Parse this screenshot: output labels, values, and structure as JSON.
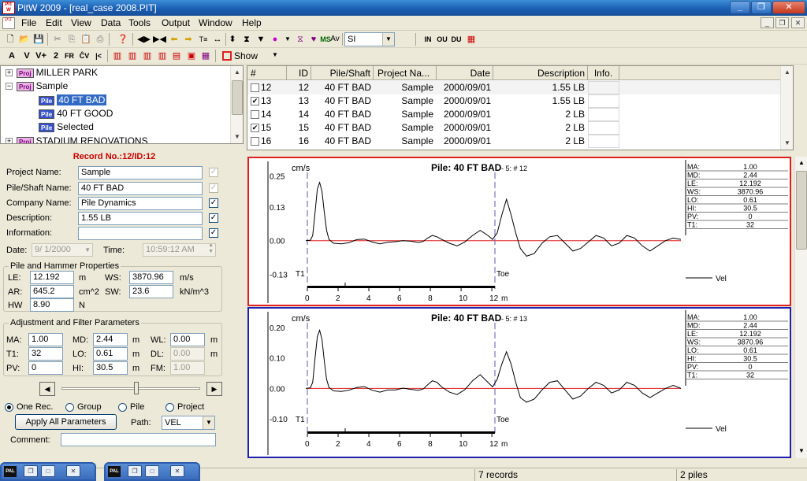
{
  "window": {
    "title": "PitW  2009 - [real_case 2008.PIT]",
    "app_icon_text": "PIT W",
    "minimize": "_",
    "maximize": "❐",
    "close": "✕"
  },
  "menu": [
    "File",
    "Edit",
    "View",
    "Data",
    "Tools",
    "Output",
    "Window",
    "Help"
  ],
  "mdi_buttons": [
    "_",
    "❐",
    "✕"
  ],
  "toolbar1": {
    "units_select": "SI",
    "in_label": "IN",
    "ou_label": "OU",
    "du_label": "DU",
    "av_label": "Av",
    "ms_label": "MS"
  },
  "toolbar2": {
    "buttons": [
      "A",
      "V",
      "V+",
      "2",
      "FR",
      "ĈV",
      "|<"
    ],
    "show_label": "Show"
  },
  "tree": {
    "items": [
      {
        "label": "MILLER PARK",
        "badge": "Proj",
        "expander": "+"
      },
      {
        "label": "Sample",
        "badge": "Proj",
        "expander": "−"
      },
      {
        "label": "40 FT BAD",
        "badge": "Pile",
        "selected": true
      },
      {
        "label": "40 FT GOOD",
        "badge": "Pile"
      },
      {
        "label": "Selected",
        "badge": "Pile"
      },
      {
        "label": "STADIUM RENOVATIONS",
        "badge": "Proj",
        "expander": "+"
      }
    ]
  },
  "record": {
    "title": "Record No.:12/ID:12",
    "project_name_label": "Project Name:",
    "project_name": "Sample",
    "pile_name_label": "Pile/Shaft Name:",
    "pile_name": "40 FT BAD",
    "company_name_label": "Company Name:",
    "company_name": "Pile Dynamics",
    "description_label": "Description:",
    "description": "1.55 LB",
    "information_label": "Information:",
    "information": "",
    "date_label": "Date:",
    "date": "9/ 1/2000",
    "time_label": "Time:",
    "time": "10:59:12 AM"
  },
  "pile_hammer": {
    "title": "Pile and Hammer Properties",
    "le_label": "LE:",
    "le": "12.192",
    "le_unit": "m",
    "ws_label": "WS:",
    "ws": "3870.96",
    "ws_unit": "m/s",
    "ar_label": "AR:",
    "ar": "645.2",
    "ar_unit": "cm^2",
    "sw_label": "SW:",
    "sw": "23.6",
    "sw_unit": "kN/m^3",
    "hw_label": "HW",
    "hw": "8.90",
    "hw_unit": "N"
  },
  "adjust": {
    "title": "Adjustment and Filter Parameters",
    "ma_label": "MA:",
    "ma": "1.00",
    "md_label": "MD:",
    "md": "2.44",
    "md_unit": "m",
    "wl_label": "WL:",
    "wl": "0.00",
    "wl_unit": "m",
    "t1_label": "T1:",
    "t1": "32",
    "lo_label": "LO:",
    "lo": "0.61",
    "lo_unit": "m",
    "dl_label": "DL:",
    "dl": "0.00",
    "dl_unit": "m",
    "pv_label": "PV:",
    "pv": "0",
    "hi_label": "HI:",
    "hi": "30.5",
    "hi_unit": "m",
    "fm_label": "FM:",
    "fm": "1.00"
  },
  "scope": {
    "one_rec": "One Rec.",
    "group": "Group",
    "pile": "Pile",
    "project": "Project",
    "apply_button": "Apply All Parameters",
    "path_label": "Path:",
    "path_value": "VEL",
    "comment_label": "Comment:",
    "comment": ""
  },
  "table": {
    "columns": [
      "#",
      "ID",
      "Pile/Shaft",
      "Project Na...",
      "Date",
      "Description",
      "Info."
    ],
    "rows": [
      {
        "num": "12",
        "checked": false,
        "id": "12",
        "pile": "40 FT BAD",
        "project": "Sample",
        "date": "2000/09/01",
        "desc": "1.55 LB"
      },
      {
        "num": "13",
        "checked": true,
        "id": "13",
        "pile": "40 FT BAD",
        "project": "Sample",
        "date": "2000/09/01",
        "desc": "1.55 LB"
      },
      {
        "num": "14",
        "checked": false,
        "id": "14",
        "pile": "40 FT BAD",
        "project": "Sample",
        "date": "2000/09/01",
        "desc": "2 LB"
      },
      {
        "num": "15",
        "checked": true,
        "id": "15",
        "pile": "40 FT BAD",
        "project": "Sample",
        "date": "2000/09/01",
        "desc": "2 LB"
      },
      {
        "num": "16",
        "checked": false,
        "id": "16",
        "pile": "40 FT BAD",
        "project": "Sample",
        "date": "2000/09/01",
        "desc": "2 LB"
      }
    ]
  },
  "chart_data": [
    {
      "type": "line",
      "title": "Pile: 40 FT BAD",
      "subtitle": "- 5: # 12",
      "ylabel": "cm/s",
      "xlabel": "m",
      "yticks": [
        "0.25",
        "0.13",
        "0.00",
        "-0.13"
      ],
      "ytick_values": [
        0.25,
        0.13,
        0.0,
        -0.13
      ],
      "ylim": [
        -0.15,
        0.27
      ],
      "xlim": [
        0,
        12.2
      ],
      "xticks": [
        "0",
        "2",
        "4",
        "6",
        "8",
        "10",
        "12"
      ],
      "markers": [
        {
          "label": "T1",
          "x": 0
        },
        {
          "label": "Toe",
          "x": 12.192
        }
      ],
      "legend": "Vel",
      "border_color": "#e02020",
      "params": [
        [
          "MA:",
          "1.00"
        ],
        [
          "MD:",
          "2.44"
        ],
        [
          "LE:",
          "12.192"
        ],
        [
          "WS:",
          "3870.96"
        ],
        [
          "LO:",
          "0.61"
        ],
        [
          "HI:",
          "30.5"
        ],
        [
          "PV:",
          "0"
        ],
        [
          "T1:",
          "32"
        ]
      ],
      "series": [
        {
          "x": [
            -0.3,
            0,
            0.15,
            0.3,
            0.45,
            0.6,
            0.75,
            0.9,
            1.05,
            1.2,
            1.5,
            2,
            2.5,
            3,
            3.5,
            4,
            4.5,
            5,
            5.5,
            6,
            6.5,
            7,
            7.3,
            7.6,
            7.9,
            8.2,
            8.5,
            9,
            9.5,
            10,
            10.5,
            11,
            11.5,
            11.8,
            12.1,
            12.4,
            12.7,
            13,
            13.3,
            13.6,
            14,
            14.5,
            15,
            15.5,
            16,
            16.5,
            17,
            17.5,
            18,
            18.5,
            19,
            19.5,
            20,
            20.5,
            21,
            21.5,
            22,
            22.5,
            23,
            23.5,
            24
          ],
          "y": [
            0,
            0.002,
            0.02,
            0.11,
            0.2,
            0.225,
            0.19,
            0.11,
            0.04,
            0.005,
            -0.01,
            -0.012,
            -0.008,
            0.004,
            0.006,
            -0.005,
            -0.012,
            -0.006,
            -0.004,
            0.0,
            -0.002,
            -0.007,
            -0.003,
            0.01,
            0.02,
            0.015,
            0.005,
            -0.01,
            -0.02,
            -0.005,
            0.02,
            0.04,
            0.02,
            0.005,
            0.03,
            0.1,
            0.16,
            0.1,
            0.03,
            -0.03,
            -0.06,
            -0.05,
            -0.01,
            0.015,
            0.02,
            -0.01,
            -0.04,
            -0.03,
            -0.005,
            0.02,
            0.01,
            -0.02,
            -0.01,
            0.02,
            0.01,
            -0.02,
            -0.04,
            -0.02,
            0.0,
            0.01,
            0.005
          ]
        }
      ]
    },
    {
      "type": "line",
      "title": "Pile: 40 FT BAD",
      "subtitle": "- 5: # 13",
      "ylabel": "cm/s",
      "xlabel": "m",
      "yticks": [
        "0.20",
        "0.10",
        "0.00",
        "-0.10"
      ],
      "ytick_values": [
        0.2,
        0.1,
        0.0,
        -0.1
      ],
      "ylim": [
        -0.12,
        0.22
      ],
      "xlim": [
        0,
        12.2
      ],
      "xticks": [
        "0",
        "2",
        "4",
        "6",
        "8",
        "10",
        "12"
      ],
      "markers": [
        {
          "label": "T1",
          "x": 0
        },
        {
          "label": "Toe",
          "x": 12.192
        }
      ],
      "legend": "Vel",
      "border_color": "#2020b0",
      "params": [
        [
          "MA:",
          "1.00"
        ],
        [
          "MD:",
          "2.44"
        ],
        [
          "LE:",
          "12.192"
        ],
        [
          "WS:",
          "3870.96"
        ],
        [
          "LO:",
          "0.61"
        ],
        [
          "HI:",
          "30.5"
        ],
        [
          "PV:",
          "0"
        ],
        [
          "T1:",
          "32"
        ]
      ],
      "series": [
        {
          "x": [
            -0.3,
            0,
            0.15,
            0.3,
            0.45,
            0.6,
            0.75,
            0.9,
            1.05,
            1.2,
            1.5,
            2,
            2.5,
            3,
            3.5,
            4,
            4.5,
            5,
            5.5,
            6,
            6.5,
            7,
            7.3,
            7.6,
            7.9,
            8.2,
            8.5,
            9,
            9.5,
            10,
            10.5,
            11,
            11.5,
            11.8,
            12.1,
            12.4,
            12.7,
            13,
            13.3,
            13.6,
            14,
            14.5,
            15,
            15.5,
            16,
            16.5,
            17,
            17.5,
            18,
            18.5,
            19,
            19.5,
            20,
            20.5,
            21,
            21.5,
            22,
            22.5,
            23,
            23.5,
            24
          ],
          "y": [
            0,
            0.002,
            0.02,
            0.1,
            0.17,
            0.19,
            0.16,
            0.09,
            0.03,
            0.003,
            -0.008,
            -0.01,
            -0.006,
            0.003,
            0.006,
            -0.006,
            -0.012,
            -0.005,
            -0.005,
            0.001,
            -0.003,
            -0.006,
            -0.002,
            0.012,
            0.025,
            0.02,
            0.005,
            -0.012,
            -0.02,
            -0.004,
            0.025,
            0.045,
            0.02,
            0.005,
            0.03,
            0.08,
            0.12,
            0.08,
            0.02,
            -0.03,
            -0.045,
            -0.035,
            -0.005,
            0.02,
            0.025,
            -0.005,
            -0.035,
            -0.025,
            0.0,
            0.02,
            0.01,
            -0.015,
            -0.005,
            0.02,
            0.01,
            -0.015,
            -0.03,
            -0.015,
            0.0,
            0.01,
            0.0
          ]
        }
      ]
    }
  ],
  "status": {
    "records": "7 records",
    "piles": "2 piles"
  },
  "mini_windows": [
    {
      "label": "PAL"
    },
    {
      "label": "PAL"
    }
  ]
}
